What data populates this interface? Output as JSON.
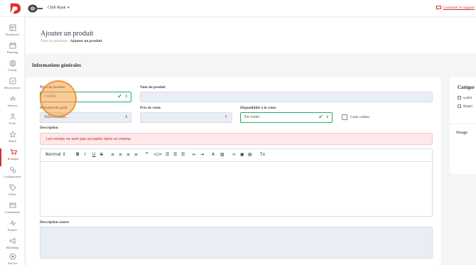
{
  "topbar": {
    "club_name": "Club Ryan",
    "club_caret": "▾",
    "support_link": "Contacter le support"
  },
  "sidebar": {
    "items": [
      {
        "label": "Dashboard",
        "icon": "dashboard-icon"
      },
      {
        "label": "Planning",
        "icon": "calendar-icon"
      },
      {
        "label": "Clients",
        "icon": "user-icon"
      },
      {
        "label": "Réservations",
        "icon": "booking-icon"
      },
      {
        "label": "Séances",
        "icon": "sessions-icon"
      },
      {
        "label": "Ecole",
        "icon": "school-icon"
      },
      {
        "label": "Match",
        "icon": "star-icon"
      },
      {
        "label": "Boutique",
        "icon": "cart-icon"
      },
      {
        "label": "Configuration",
        "icon": "gears-icon"
      },
      {
        "label": "Offres",
        "icon": "tag-icon"
      },
      {
        "label": "Commandes",
        "icon": "orders-icon"
      },
      {
        "label": "Exports",
        "icon": "exports-icon"
      },
      {
        "label": "Marketing",
        "icon": "megaphone-icon"
      },
      {
        "label": "Articles",
        "icon": "article-icon"
      }
    ],
    "active_index": 7,
    "accent": "#d32f2f"
  },
  "header": {
    "title": "Ajouter un produit",
    "breadcrumb_root": "Tous les produits /",
    "breadcrumb_current": "Ajouter un produit"
  },
  "section_title": "Informations générales",
  "form": {
    "type_label": "Type de produit",
    "type_value": "Crédits",
    "name_label": "Nom du produit",
    "name_value": "",
    "pack_label": "Sélection du pack",
    "pack_value": "Sélectionner...",
    "price_label": "Prix de vente",
    "price_unit": "€",
    "availability_label": "Disponibilité à la vente",
    "availability_value": "En vente",
    "gift_card_label": "Carte cadeau",
    "description_label": "Description",
    "description_error": "Les emojis ne sont pas acceptés dans ce champ",
    "short_description_label": "Description courte",
    "check": "✔",
    "select_arrow": "⇕"
  },
  "toolbar": {
    "style": "Normal",
    "bold": "B",
    "italic": "I",
    "underline": "U",
    "strike": "S",
    "quote": "❞",
    "code": "</>",
    "clean": "Tx"
  },
  "right_panel": {
    "categories_title": "Catégor",
    "options": [
      "wallet",
      "Matéri"
    ],
    "image_title": "Image"
  },
  "colors": {
    "accent": "#d32f2f",
    "valid": "#29a865",
    "highlight": "#f7a042"
  }
}
